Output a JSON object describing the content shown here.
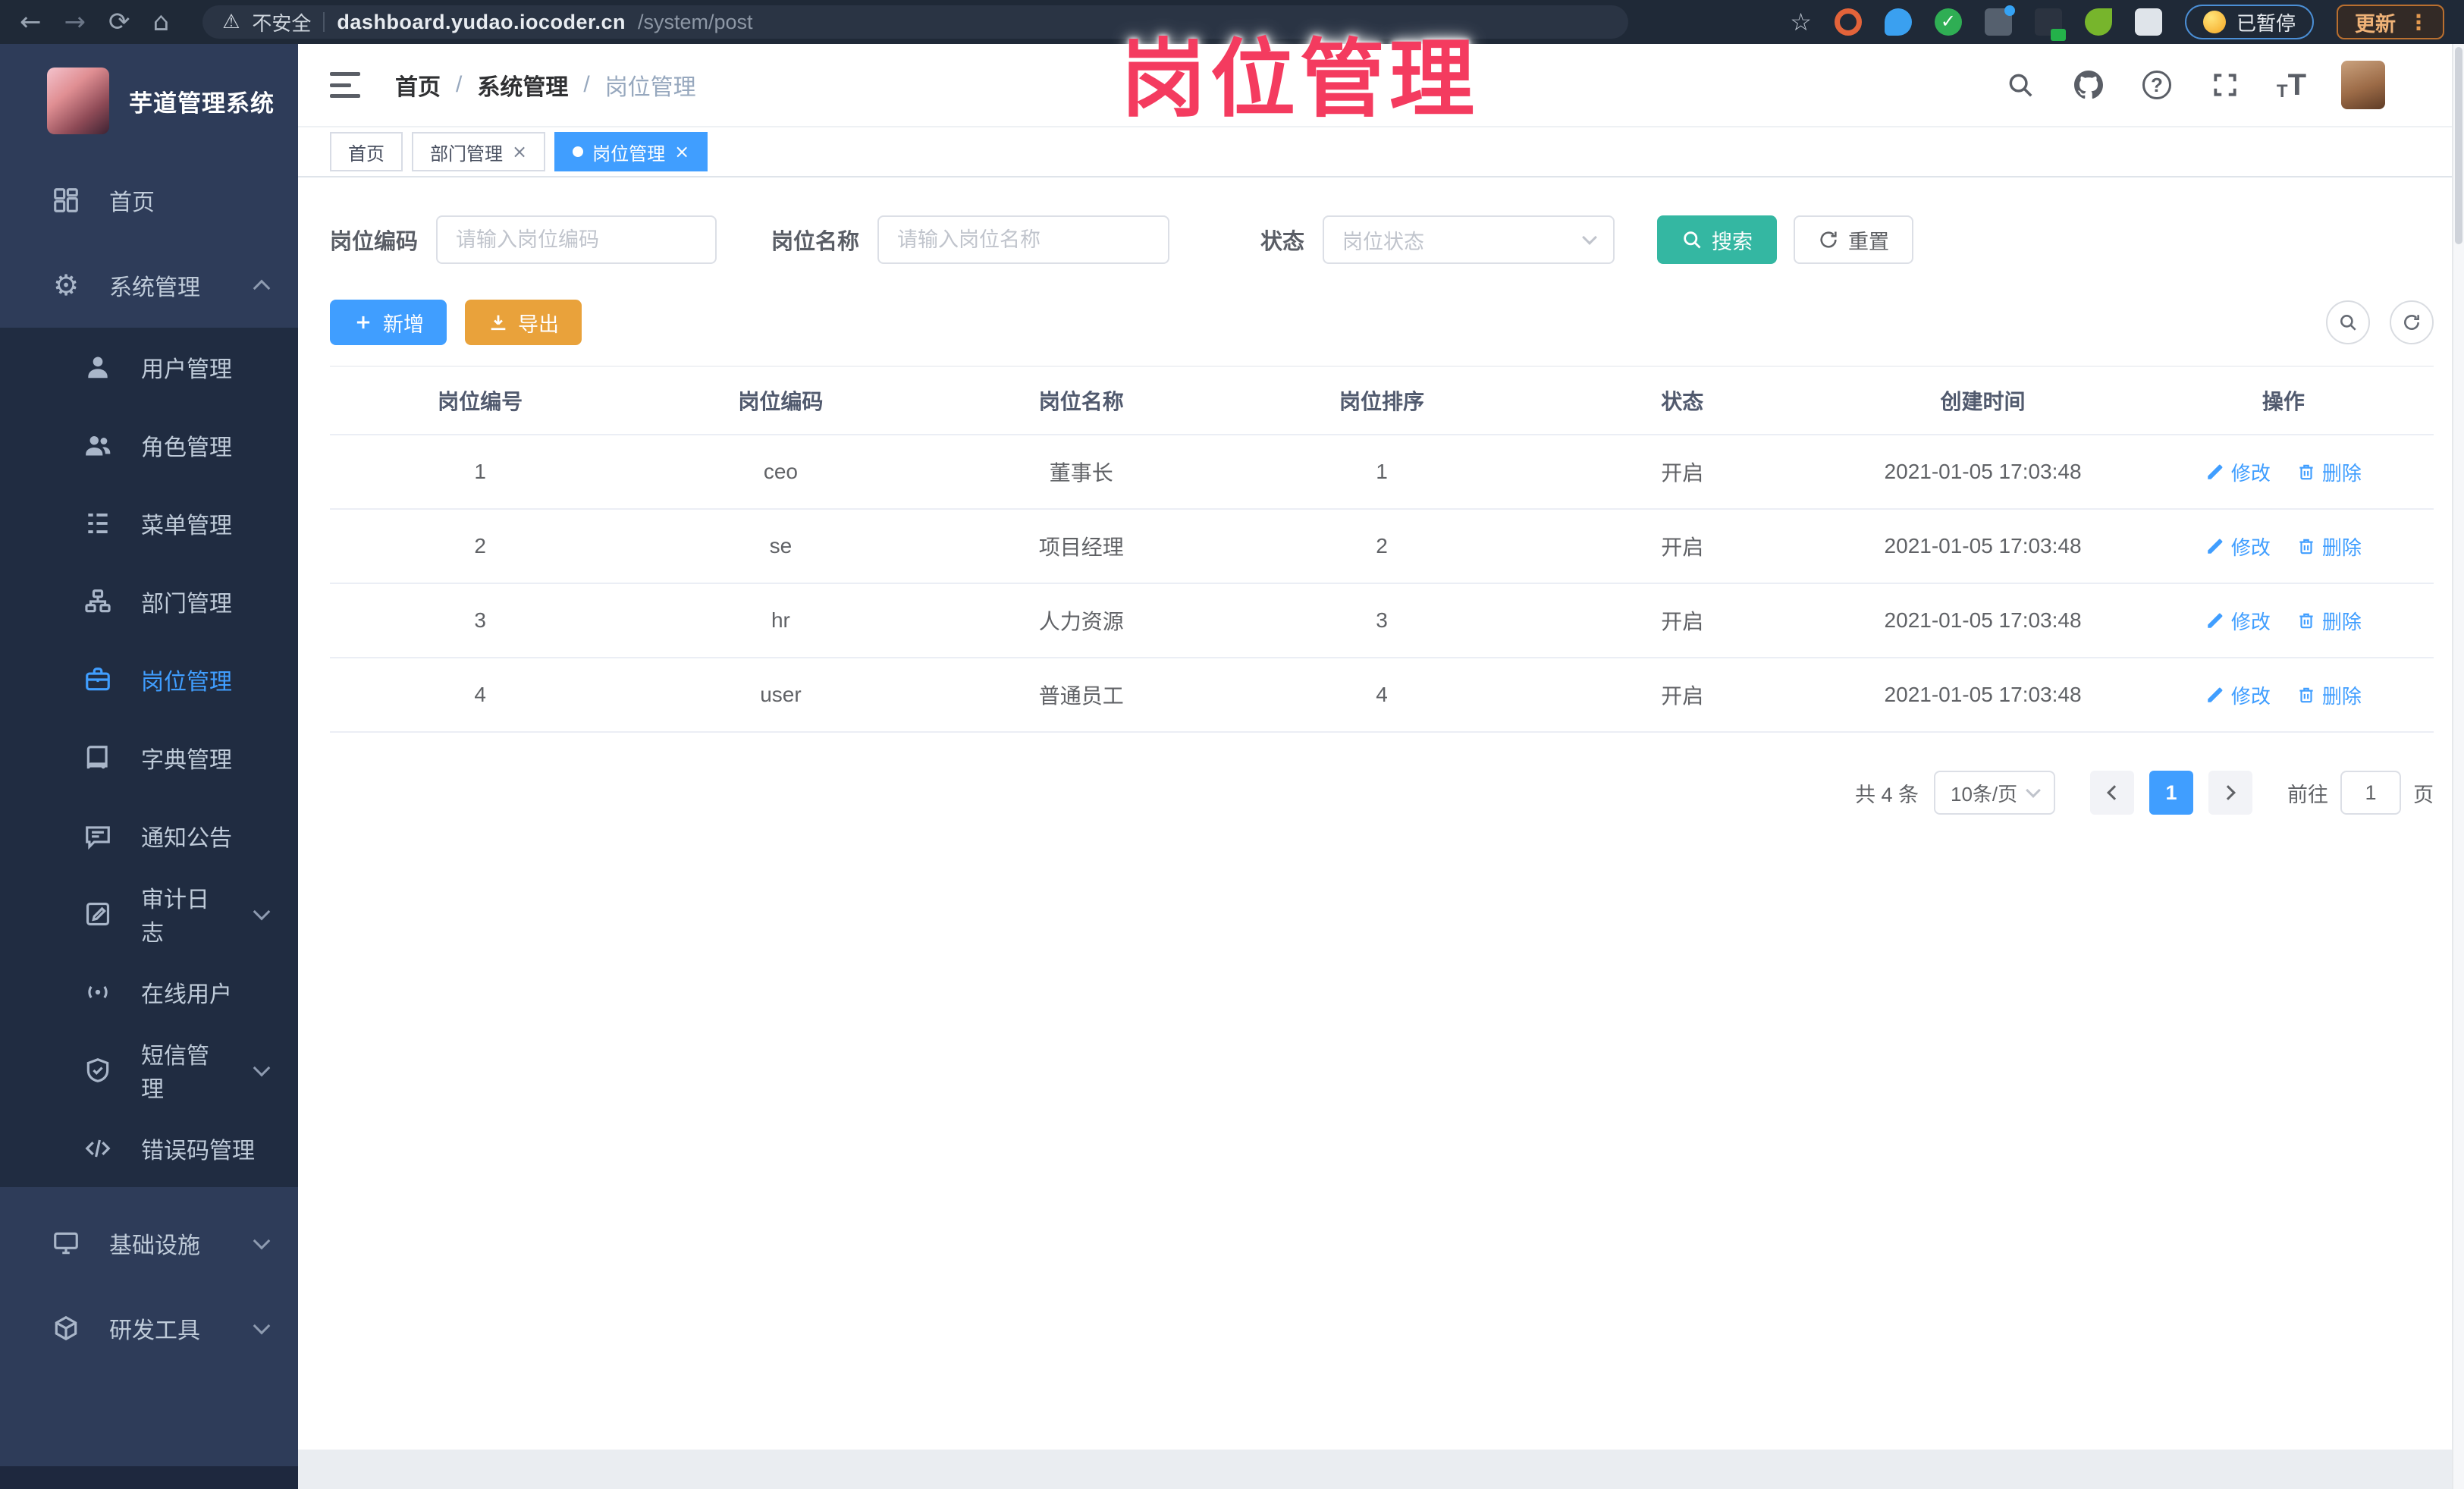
{
  "browser": {
    "security_label": "不安全",
    "url_host": "dashboard.yudao.iocoder.cn",
    "url_path": "/system/post",
    "paused_label": "已暂停",
    "update_label": "更新"
  },
  "icons": {
    "back": "←",
    "forward": "→",
    "reload": "⟳",
    "home": "⌂",
    "warning": "⚠",
    "star": "☆",
    "kebab": "⋮",
    "close": "×",
    "question": "?",
    "gear": "⚙",
    "separator": "/",
    "font_small": "T",
    "font_big": "T",
    "check": "✓"
  },
  "watermark": "岗位管理",
  "sidebar": {
    "title": "芋道管理系统",
    "home_label": "首页",
    "system_label": "系统管理",
    "submenu": [
      {
        "label": "用户管理"
      },
      {
        "label": "角色管理"
      },
      {
        "label": "菜单管理"
      },
      {
        "label": "部门管理"
      },
      {
        "label": "岗位管理"
      },
      {
        "label": "字典管理"
      },
      {
        "label": "通知公告"
      },
      {
        "label": "审计日志"
      },
      {
        "label": "在线用户"
      },
      {
        "label": "短信管理"
      },
      {
        "label": "错误码管理"
      }
    ],
    "infra_label": "基础设施",
    "devtools_label": "研发工具"
  },
  "header": {
    "breadcrumb": [
      "首页",
      "系统管理",
      "岗位管理"
    ]
  },
  "tabs": [
    {
      "label": "首页"
    },
    {
      "label": "部门管理"
    },
    {
      "label": "岗位管理"
    }
  ],
  "filters": {
    "post_code_label": "岗位编码",
    "post_code_placeholder": "请输入岗位编码",
    "post_name_label": "岗位名称",
    "post_name_placeholder": "请输入岗位名称",
    "status_label": "状态",
    "status_placeholder": "岗位状态",
    "search_label": "搜索",
    "reset_label": "重置"
  },
  "toolbar": {
    "add_label": "新增",
    "export_label": "导出"
  },
  "table": {
    "headers": [
      "岗位编号",
      "岗位编码",
      "岗位名称",
      "岗位排序",
      "状态",
      "创建时间",
      "操作"
    ],
    "rows": [
      [
        "1",
        "ceo",
        "董事长",
        "1",
        "开启",
        "2021-01-05 17:03:48"
      ],
      [
        "2",
        "se",
        "项目经理",
        "2",
        "开启",
        "2021-01-05 17:03:48"
      ],
      [
        "3",
        "hr",
        "人力资源",
        "3",
        "开启",
        "2021-01-05 17:03:48"
      ],
      [
        "4",
        "user",
        "普通员工",
        "4",
        "开启",
        "2021-01-05 17:03:48"
      ]
    ],
    "op_edit": "修改",
    "op_delete": "删除"
  },
  "pagination": {
    "total_text": "共 4 条",
    "page_size": "10条/页",
    "current_page": "1",
    "goto_prefix": "前往",
    "goto_value": "1",
    "goto_suffix": "页"
  },
  "colors": {
    "accent": "#409eff",
    "sidebar_bg": "#2e3c59",
    "submenu_bg": "#202c41",
    "search_teal": "#34b7a2",
    "export_orange": "#e9a23b",
    "watermark_pink": "#f43b5f"
  }
}
